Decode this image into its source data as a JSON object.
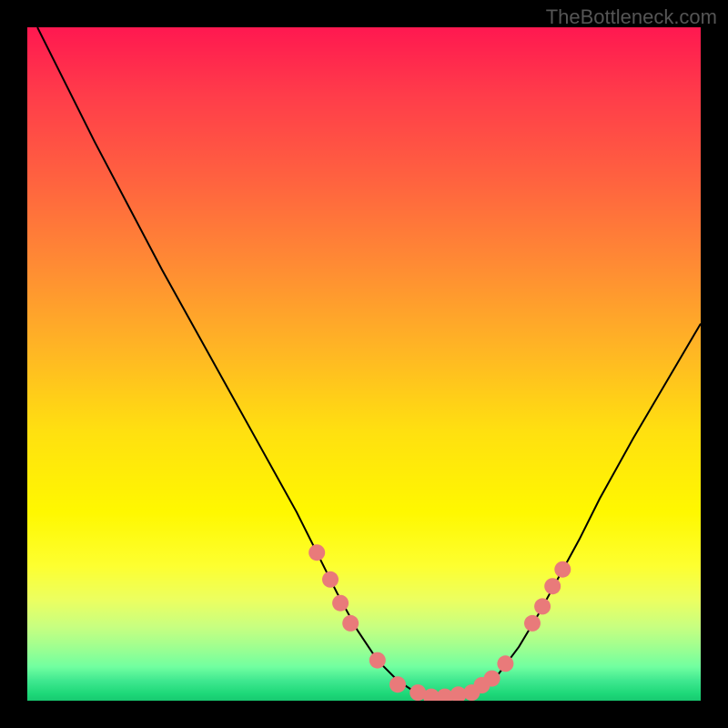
{
  "watermark": "TheBottleneck.com",
  "chart_data": {
    "type": "line",
    "title": "",
    "xlabel": "",
    "ylabel": "",
    "xlim": [
      0,
      100
    ],
    "ylim": [
      0,
      100
    ],
    "curve": {
      "name": "bottleneck-curve",
      "description": "V-shaped curve representing bottleneck percentage, minimum near x≈60",
      "points": [
        {
          "x": 1.5,
          "y": 100
        },
        {
          "x": 5,
          "y": 93
        },
        {
          "x": 10,
          "y": 83
        },
        {
          "x": 15,
          "y": 73.5
        },
        {
          "x": 20,
          "y": 64
        },
        {
          "x": 25,
          "y": 55
        },
        {
          "x": 30,
          "y": 46
        },
        {
          "x": 35,
          "y": 37
        },
        {
          "x": 40,
          "y": 28
        },
        {
          "x": 43,
          "y": 22
        },
        {
          "x": 46,
          "y": 16
        },
        {
          "x": 49,
          "y": 10.5
        },
        {
          "x": 52,
          "y": 6
        },
        {
          "x": 55,
          "y": 3
        },
        {
          "x": 58,
          "y": 1
        },
        {
          "x": 61,
          "y": 0.3
        },
        {
          "x": 64,
          "y": 0.5
        },
        {
          "x": 67,
          "y": 1.8
        },
        {
          "x": 70,
          "y": 4
        },
        {
          "x": 73,
          "y": 8
        },
        {
          "x": 76,
          "y": 13
        },
        {
          "x": 79,
          "y": 18.5
        },
        {
          "x": 82,
          "y": 24
        },
        {
          "x": 85,
          "y": 30
        },
        {
          "x": 90,
          "y": 39
        },
        {
          "x": 95,
          "y": 47.5
        },
        {
          "x": 100,
          "y": 56
        }
      ]
    },
    "dots": {
      "name": "sample-dots",
      "description": "Pink dots near bottom of V",
      "color": "#e97a7a",
      "radius": 9,
      "points": [
        {
          "x": 43,
          "y": 22
        },
        {
          "x": 45,
          "y": 18
        },
        {
          "x": 46.5,
          "y": 14.5
        },
        {
          "x": 48,
          "y": 11.5
        },
        {
          "x": 52,
          "y": 6
        },
        {
          "x": 55,
          "y": 2.4
        },
        {
          "x": 58,
          "y": 1.2
        },
        {
          "x": 60,
          "y": 0.6
        },
        {
          "x": 62,
          "y": 0.6
        },
        {
          "x": 64,
          "y": 0.9
        },
        {
          "x": 66,
          "y": 1.2
        },
        {
          "x": 67.5,
          "y": 2.3
        },
        {
          "x": 69,
          "y": 3.3
        },
        {
          "x": 71,
          "y": 5.5
        },
        {
          "x": 75,
          "y": 11.5
        },
        {
          "x": 76.5,
          "y": 14
        },
        {
          "x": 78,
          "y": 17
        },
        {
          "x": 79.5,
          "y": 19.5
        }
      ]
    },
    "gradient_stops": [
      {
        "pos": 0,
        "color": "#ff1850"
      },
      {
        "pos": 10,
        "color": "#ff3c4a"
      },
      {
        "pos": 22,
        "color": "#ff6040"
      },
      {
        "pos": 35,
        "color": "#ff8a34"
      },
      {
        "pos": 48,
        "color": "#ffb624"
      },
      {
        "pos": 60,
        "color": "#ffe010"
      },
      {
        "pos": 72,
        "color": "#fff800"
      },
      {
        "pos": 80,
        "color": "#fdff30"
      },
      {
        "pos": 85,
        "color": "#ecff60"
      },
      {
        "pos": 89,
        "color": "#c8ff80"
      },
      {
        "pos": 92,
        "color": "#a0ff90"
      },
      {
        "pos": 95,
        "color": "#70ffa0"
      },
      {
        "pos": 97,
        "color": "#40e890"
      },
      {
        "pos": 99,
        "color": "#1dd878"
      },
      {
        "pos": 100,
        "color": "#18c870"
      }
    ]
  }
}
